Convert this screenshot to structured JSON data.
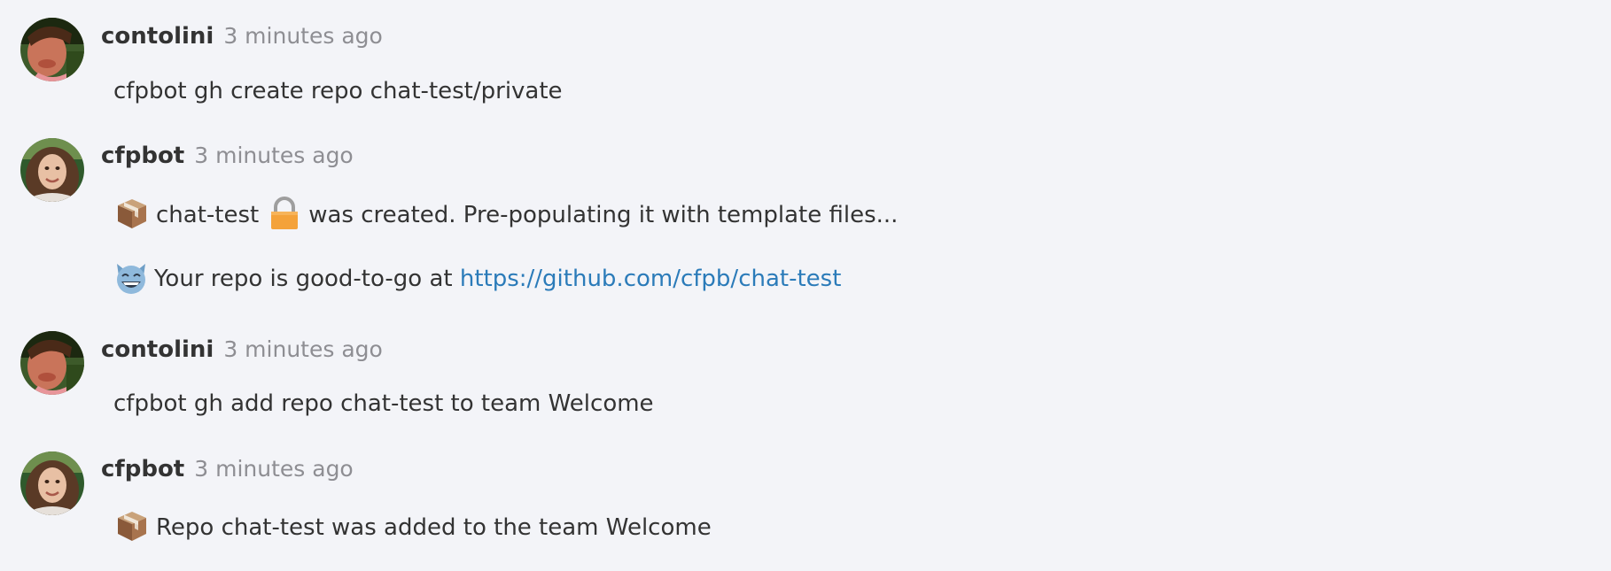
{
  "messages": [
    {
      "author": "contolini",
      "timestamp": "3 minutes ago",
      "avatar": "contolini-avatar",
      "lines": [
        {
          "text": "cfpbot gh create repo chat-test/private"
        }
      ]
    },
    {
      "author": "cfpbot",
      "timestamp": "3 minutes ago",
      "avatar": "cfpbot-avatar",
      "lines": [
        {
          "lead_icon": "package-icon",
          "part1": "chat-test",
          "mid_icon": "lock-icon",
          "part2": "was created. Pre-populating it with template files..."
        },
        {
          "lead_icon": "smiley-cat-icon",
          "text": "Your repo is good-to-go at",
          "link": "https://github.com/cfpb/chat-test"
        }
      ]
    },
    {
      "author": "contolini",
      "timestamp": "3 minutes ago",
      "avatar": "contolini-avatar",
      "lines": [
        {
          "text": "cfpbot gh add repo chat-test to team Welcome"
        }
      ]
    },
    {
      "author": "cfpbot",
      "timestamp": "3 minutes ago",
      "avatar": "cfpbot-avatar",
      "lines": [
        {
          "lead_icon": "package-icon",
          "text": "Repo chat-test was added to the team Welcome"
        }
      ]
    }
  ],
  "colors": {
    "background": "#f3f4f8",
    "text": "#333333",
    "timestamp": "#8e8e93",
    "link": "#2b7bb9"
  }
}
